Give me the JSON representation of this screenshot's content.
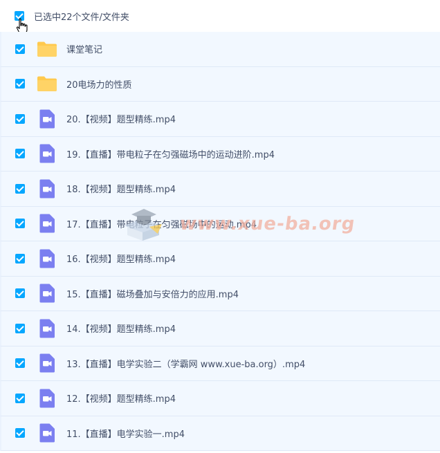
{
  "header": {
    "select_label": "已选中22个文件/文件夹"
  },
  "files": [
    {
      "name": "课堂笔记",
      "type": "folder"
    },
    {
      "name": "20电场力的性质",
      "type": "folder"
    },
    {
      "name": "20.【视频】题型精练.mp4",
      "type": "video"
    },
    {
      "name": "19.【直播】带电粒子在匀强磁场中的运动进阶.mp4",
      "type": "video"
    },
    {
      "name": "18.【视频】题型精练.mp4",
      "type": "video"
    },
    {
      "name": "17.【直播】带电粒子在匀强磁场中的运动.mp4",
      "type": "video"
    },
    {
      "name": "16.【视频】题型精练.mp4",
      "type": "video"
    },
    {
      "name": "15.【直播】磁场叠加与安倍力的应用.mp4",
      "type": "video"
    },
    {
      "name": "14.【视频】题型精练.mp4",
      "type": "video"
    },
    {
      "name": "13.【直播】电学实验二（学霸网 www.xue-ba.org）.mp4",
      "type": "video"
    },
    {
      "name": "12.【视频】题型精练.mp4",
      "type": "video"
    },
    {
      "name": "11.【直播】电学实验一.mp4",
      "type": "video"
    }
  ],
  "watermark": {
    "text": "www.xue-ba.org"
  },
  "colors": {
    "checkbox": "#06a7ff",
    "folder": "#ffc94d",
    "video": "#7b7ff0",
    "row_bg": "#f2f8ff",
    "text": "#424e67"
  }
}
